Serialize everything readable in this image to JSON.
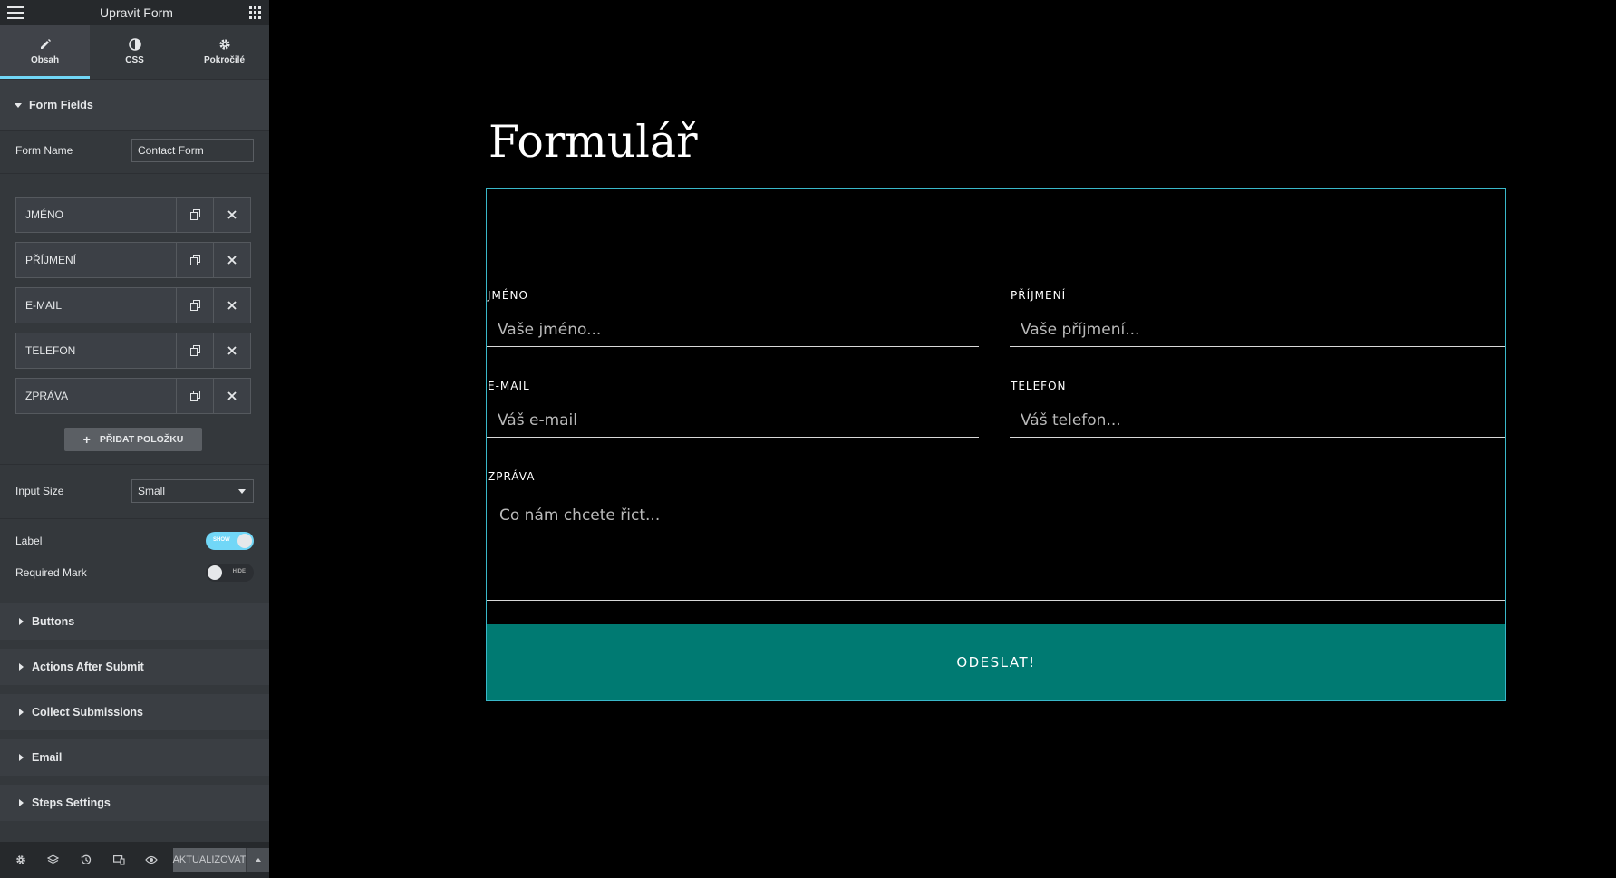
{
  "app": {
    "title": "Upravit Form",
    "accent": "#71d7f7",
    "brand": "#007a72"
  },
  "tabs": [
    {
      "label": "Obsah",
      "icon": "pencil-icon"
    },
    {
      "label": "CSS",
      "icon": "contrast-icon"
    },
    {
      "label": "Pokročilé",
      "icon": "gear-icon"
    }
  ],
  "form_fields_section": {
    "title": "Form Fields",
    "form_name_label": "Form Name",
    "form_name_value": "Contact Form",
    "items": [
      {
        "label": "JMÉNO"
      },
      {
        "label": "PŘÍJMENÍ"
      },
      {
        "label": "E-MAIL"
      },
      {
        "label": "TELEFON"
      },
      {
        "label": "ZPRÁVA"
      }
    ],
    "add_item_label": "PŘIDAT POLOŽKU",
    "input_size_label": "Input Size",
    "input_size_value": "Small",
    "label_toggle": {
      "label": "Label",
      "state_text": "SHOW"
    },
    "required_toggle": {
      "label": "Required Mark",
      "state_text": "HIDE"
    }
  },
  "collapsed_sections": [
    "Buttons",
    "Actions After Submit",
    "Collect Submissions",
    "Email",
    "Steps Settings"
  ],
  "footer": {
    "publish_label": "AKTUALIZOVAT"
  },
  "canvas": {
    "heading": "Formulář",
    "fields": {
      "first_name": {
        "label": "JMÉNO",
        "placeholder": "Vaše jméno..."
      },
      "last_name": {
        "label": "PŘÍJMENÍ",
        "placeholder": "Vaše příjmení..."
      },
      "email": {
        "label": "E-MAIL",
        "placeholder": "Váš e-mail"
      },
      "phone": {
        "label": "TELEFON",
        "placeholder": "Váš telefon..."
      },
      "message": {
        "label": "ZPRÁVA",
        "placeholder": "Co nám chcete řict..."
      }
    },
    "submit_label": "ODESLAT!"
  }
}
